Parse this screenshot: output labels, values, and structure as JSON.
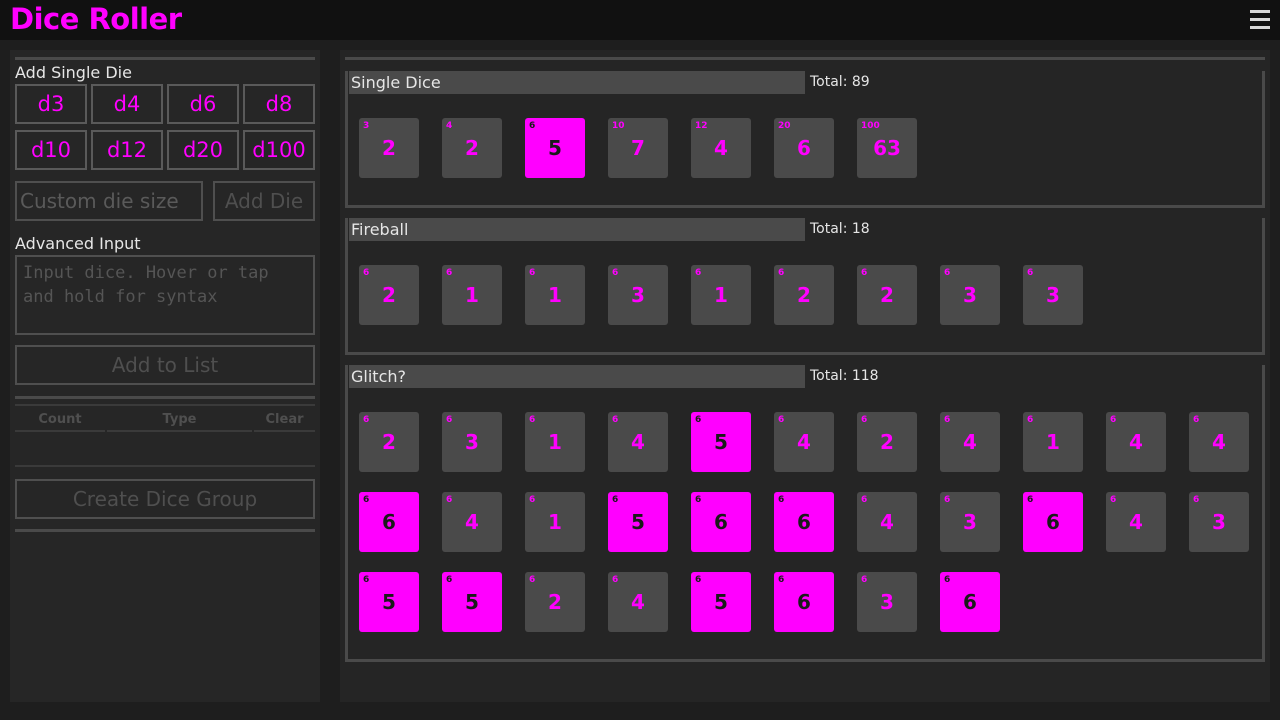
{
  "header": {
    "title": "Dice Roller",
    "menu_icon": "hamburger-menu-icon"
  },
  "sidebar": {
    "add_single_label": "Add Single Die",
    "die_buttons": [
      "d3",
      "d4",
      "d6",
      "d8",
      "d10",
      "d12",
      "d20",
      "d100"
    ],
    "custom_die_placeholder": "Custom die size",
    "add_die_label": "Add Die",
    "advanced_label": "Advanced Input",
    "advanced_placeholder": "Input dice. Hover or tap and hold for syntax",
    "add_to_list_label": "Add to List",
    "table_headers": [
      "Count",
      "Type",
      "Clear"
    ],
    "create_group_label": "Create Dice Group"
  },
  "colors": {
    "accent": "#ff00ff",
    "die_bg": "#4a4a4a",
    "header_bg": "#111111"
  },
  "groups": [
    {
      "title": "Single Dice",
      "total": "Total: 89",
      "dice": [
        {
          "size": "3",
          "value": "2",
          "max": false
        },
        {
          "size": "4",
          "value": "2",
          "max": false
        },
        {
          "size": "6",
          "value": "5",
          "max": true
        },
        {
          "size": "10",
          "value": "7",
          "max": false
        },
        {
          "size": "12",
          "value": "4",
          "max": false
        },
        {
          "size": "20",
          "value": "6",
          "max": false
        },
        {
          "size": "100",
          "value": "63",
          "max": false
        }
      ]
    },
    {
      "title": "Fireball",
      "total": "Total: 18",
      "dice": [
        {
          "size": "6",
          "value": "2",
          "max": false
        },
        {
          "size": "6",
          "value": "1",
          "max": false
        },
        {
          "size": "6",
          "value": "1",
          "max": false
        },
        {
          "size": "6",
          "value": "3",
          "max": false
        },
        {
          "size": "6",
          "value": "1",
          "max": false
        },
        {
          "size": "6",
          "value": "2",
          "max": false
        },
        {
          "size": "6",
          "value": "2",
          "max": false
        },
        {
          "size": "6",
          "value": "3",
          "max": false
        },
        {
          "size": "6",
          "value": "3",
          "max": false
        }
      ]
    },
    {
      "title": "Glitch?",
      "total": "Total: 118",
      "dice": [
        {
          "size": "6",
          "value": "2",
          "max": false
        },
        {
          "size": "6",
          "value": "3",
          "max": false
        },
        {
          "size": "6",
          "value": "1",
          "max": false
        },
        {
          "size": "6",
          "value": "4",
          "max": false
        },
        {
          "size": "6",
          "value": "5",
          "max": true
        },
        {
          "size": "6",
          "value": "4",
          "max": false
        },
        {
          "size": "6",
          "value": "2",
          "max": false
        },
        {
          "size": "6",
          "value": "4",
          "max": false
        },
        {
          "size": "6",
          "value": "1",
          "max": false
        },
        {
          "size": "6",
          "value": "4",
          "max": false
        },
        {
          "size": "6",
          "value": "4",
          "max": false
        },
        {
          "size": "6",
          "value": "6",
          "max": true
        },
        {
          "size": "6",
          "value": "4",
          "max": false
        },
        {
          "size": "6",
          "value": "1",
          "max": false
        },
        {
          "size": "6",
          "value": "5",
          "max": true
        },
        {
          "size": "6",
          "value": "6",
          "max": true
        },
        {
          "size": "6",
          "value": "6",
          "max": true
        },
        {
          "size": "6",
          "value": "4",
          "max": false
        },
        {
          "size": "6",
          "value": "3",
          "max": false
        },
        {
          "size": "6",
          "value": "6",
          "max": true
        },
        {
          "size": "6",
          "value": "4",
          "max": false
        },
        {
          "size": "6",
          "value": "3",
          "max": false
        },
        {
          "size": "6",
          "value": "5",
          "max": true
        },
        {
          "size": "6",
          "value": "5",
          "max": true
        },
        {
          "size": "6",
          "value": "2",
          "max": false
        },
        {
          "size": "6",
          "value": "4",
          "max": false
        },
        {
          "size": "6",
          "value": "5",
          "max": true
        },
        {
          "size": "6",
          "value": "6",
          "max": true
        },
        {
          "size": "6",
          "value": "3",
          "max": false
        },
        {
          "size": "6",
          "value": "6",
          "max": true
        }
      ]
    }
  ]
}
